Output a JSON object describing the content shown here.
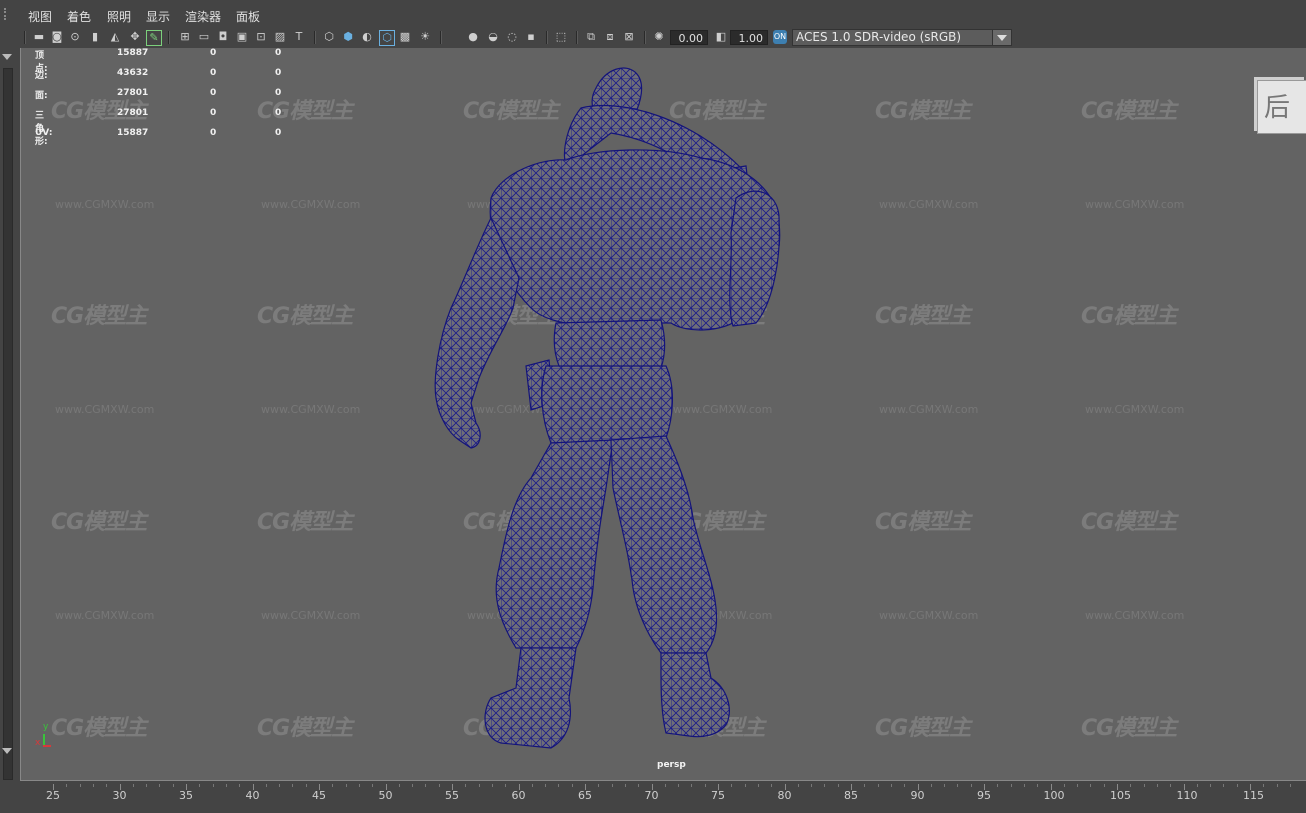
{
  "menu": [
    "视图",
    "着色",
    "照明",
    "显示",
    "渲染器",
    "面板"
  ],
  "toolbar": {
    "exposure_value": "0.00",
    "gamma_value": "1.00",
    "color_space": "ACES 1.0 SDR-video (sRGB)"
  },
  "hud": [
    {
      "label": "顶点:",
      "v1": "15887",
      "v2": "0",
      "v3": "0"
    },
    {
      "label": "边:",
      "v1": "43632",
      "v2": "0",
      "v3": "0"
    },
    {
      "label": "面:",
      "v1": "27801",
      "v2": "0",
      "v3": "0"
    },
    {
      "label": "三角形:",
      "v1": "27801",
      "v2": "0",
      "v3": "0"
    },
    {
      "label": "UV:",
      "v1": "15887",
      "v2": "0",
      "v3": "0"
    }
  ],
  "viewcube_label": "后",
  "camera_label": "persp",
  "axis": {
    "x": "x",
    "y": "y"
  },
  "watermark": {
    "logo": "CG模型主",
    "url": "www.CGMXW.com"
  },
  "timeline_ticks": [
    "25",
    "30",
    "35",
    "40",
    "45",
    "50",
    "55",
    "60",
    "65",
    "70",
    "75",
    "80",
    "85",
    "90",
    "95",
    "100",
    "105",
    "110",
    "115"
  ],
  "colors": {
    "mesh_wire": "#1a1a8a",
    "viewport_bg": "#636363",
    "ui_bg": "#444444"
  }
}
